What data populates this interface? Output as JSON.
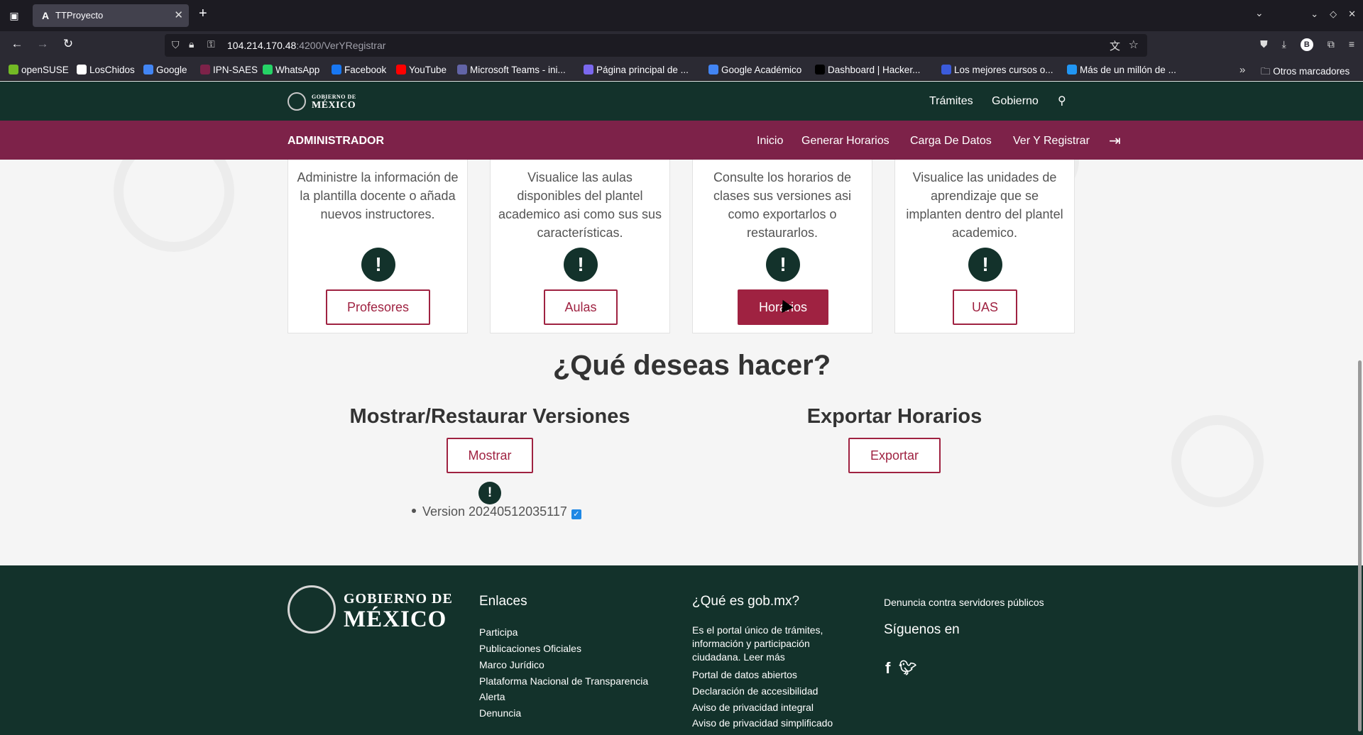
{
  "browser": {
    "tab_title": "TTProyecto",
    "tab_favicon": "A",
    "url_host": "104.214.170.48",
    "url_rest": ":4200/VerYRegistrar",
    "bookmarks": [
      {
        "label": "openSUSE",
        "color": "#73ba25"
      },
      {
        "label": "LosChidos",
        "color": "#ffffff"
      },
      {
        "label": "Google",
        "color": "#4285f4"
      },
      {
        "label": "IPN-SAES",
        "color": "#7d2249"
      },
      {
        "label": "WhatsApp",
        "color": "#25d366"
      },
      {
        "label": "Facebook",
        "color": "#1877f2"
      },
      {
        "label": "YouTube",
        "color": "#ff0000"
      },
      {
        "label": "Microsoft Teams - ini...",
        "color": "#6264a7"
      },
      {
        "label": "Página principal de ...",
        "color": "#7b68ee"
      },
      {
        "label": "Google Académico",
        "color": "#4285f4"
      },
      {
        "label": "Dashboard | Hacker...",
        "color": "#000000"
      },
      {
        "label": "Los mejores cursos o...",
        "color": "#3b5bdb"
      },
      {
        "label": "Más de un millón de ...",
        "color": "#2196f3"
      }
    ],
    "other_bookmarks": "Otros marcadores"
  },
  "gov_header": {
    "logo_line1": "GOBIERNO DE",
    "logo_line2": "MÉXICO",
    "nav": [
      "Trámites",
      "Gobierno"
    ]
  },
  "admin_bar": {
    "title": "ADMINISTRADOR",
    "links": [
      "Inicio",
      "Generar Horarios",
      "Carga De Datos",
      "Ver Y Registrar"
    ]
  },
  "cards": [
    {
      "text": "Administre la información de la plantilla docente o añada nuevos instructores.",
      "button": "Profesores"
    },
    {
      "text": "Visualice las aulas disponibles del plantel academico asi como sus sus características.",
      "button": "Aulas"
    },
    {
      "text": "Consulte los horarios de clases sus versiones asi como exportarlos o restaurarlos.",
      "button": "Horarios"
    },
    {
      "text": "Visualice las unidades de aprendizaje que se implanten dentro del plantel academico.",
      "button": "UAS"
    }
  ],
  "question": "¿Qué deseas hacer?",
  "versions_section": {
    "title": "Mostrar/Restaurar Versiones",
    "button": "Mostrar",
    "versions": [
      "Version 20240512035117"
    ]
  },
  "export_section": {
    "title": "Exportar Horarios",
    "button": "Exportar"
  },
  "footer": {
    "logo_line1": "GOBIERNO DE",
    "logo_line2": "MÉXICO",
    "enlaces_title": "Enlaces",
    "enlaces": [
      "Participa",
      "Publicaciones Oficiales",
      "Marco Jurídico",
      "Plataforma Nacional de Transparencia",
      "Alerta",
      "Denuncia"
    ],
    "gobmx_title": "¿Qué es gob.mx?",
    "gobmx_text": "Es el portal único de trámites, información y participación ciudadana. Leer más",
    "gobmx_links": [
      "Portal de datos abiertos",
      "Declaración de accesibilidad",
      "Aviso de privacidad integral",
      "Aviso de privacidad simplificado"
    ],
    "denuncia": "Denuncia contra servidores públicos",
    "siguenos": "Síguenos en",
    "social": [
      "f",
      "twitter"
    ]
  },
  "colors": {
    "gov_green": "#13322b",
    "admin_wine": "#7d2249",
    "button_wine": "#9f2241"
  }
}
